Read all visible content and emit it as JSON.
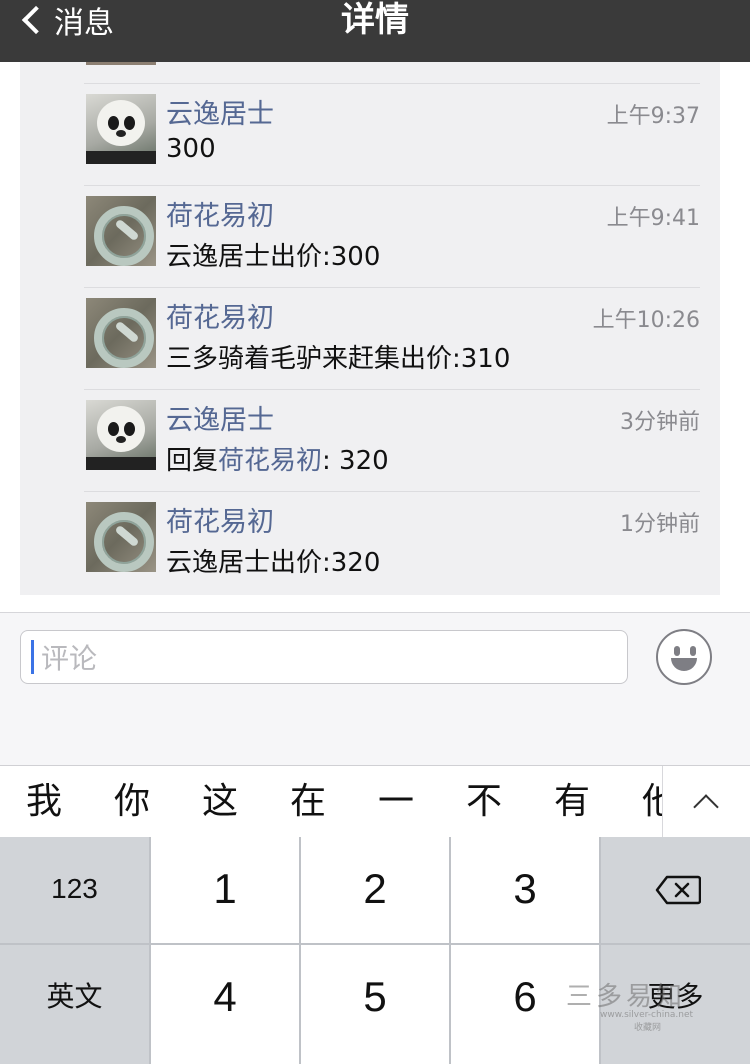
{
  "nav": {
    "back_label": "消息",
    "title": "详情"
  },
  "comments": [
    {
      "name": "云逸居士",
      "time": "上午9:37",
      "text": "300",
      "avatar": "panda-avatar"
    },
    {
      "name": "荷花易初",
      "time": "上午9:41",
      "text": "云逸居士出价:300",
      "avatar": "bangle-avatar"
    },
    {
      "name": "荷花易初",
      "time": "上午10:26",
      "text": "三多骑着毛驴来赶集出价:310",
      "avatar": "bangle-avatar"
    },
    {
      "name": "云逸居士",
      "time": "3分钟前",
      "text_prefix": "回复",
      "text_link": "荷花易初",
      "text_suffix": ": 320",
      "avatar": "panda-avatar"
    },
    {
      "name": "荷花易初",
      "time": "1分钟前",
      "text": "云逸居士出价:320",
      "avatar": "bangle-avatar"
    }
  ],
  "input": {
    "placeholder": "评论",
    "emoji_icon": "emoji-icon"
  },
  "keyboard": {
    "candidates": [
      "我",
      "你",
      "这",
      "在",
      "一",
      "不",
      "有",
      "他"
    ],
    "collapse_icon": "chevron-up-icon",
    "rows": [
      [
        "123",
        "1",
        "2",
        "3",
        "delete-icon"
      ],
      [
        "英文",
        "4",
        "5",
        "6",
        "更多"
      ]
    ]
  },
  "watermark": {
    "main": "三多易知",
    "sub": "www.silver-china.net",
    "sub2": "收藏网"
  },
  "colors": {
    "nav_bg": "#3a3a3a",
    "link": "#556893",
    "caret": "#3b73e6"
  }
}
